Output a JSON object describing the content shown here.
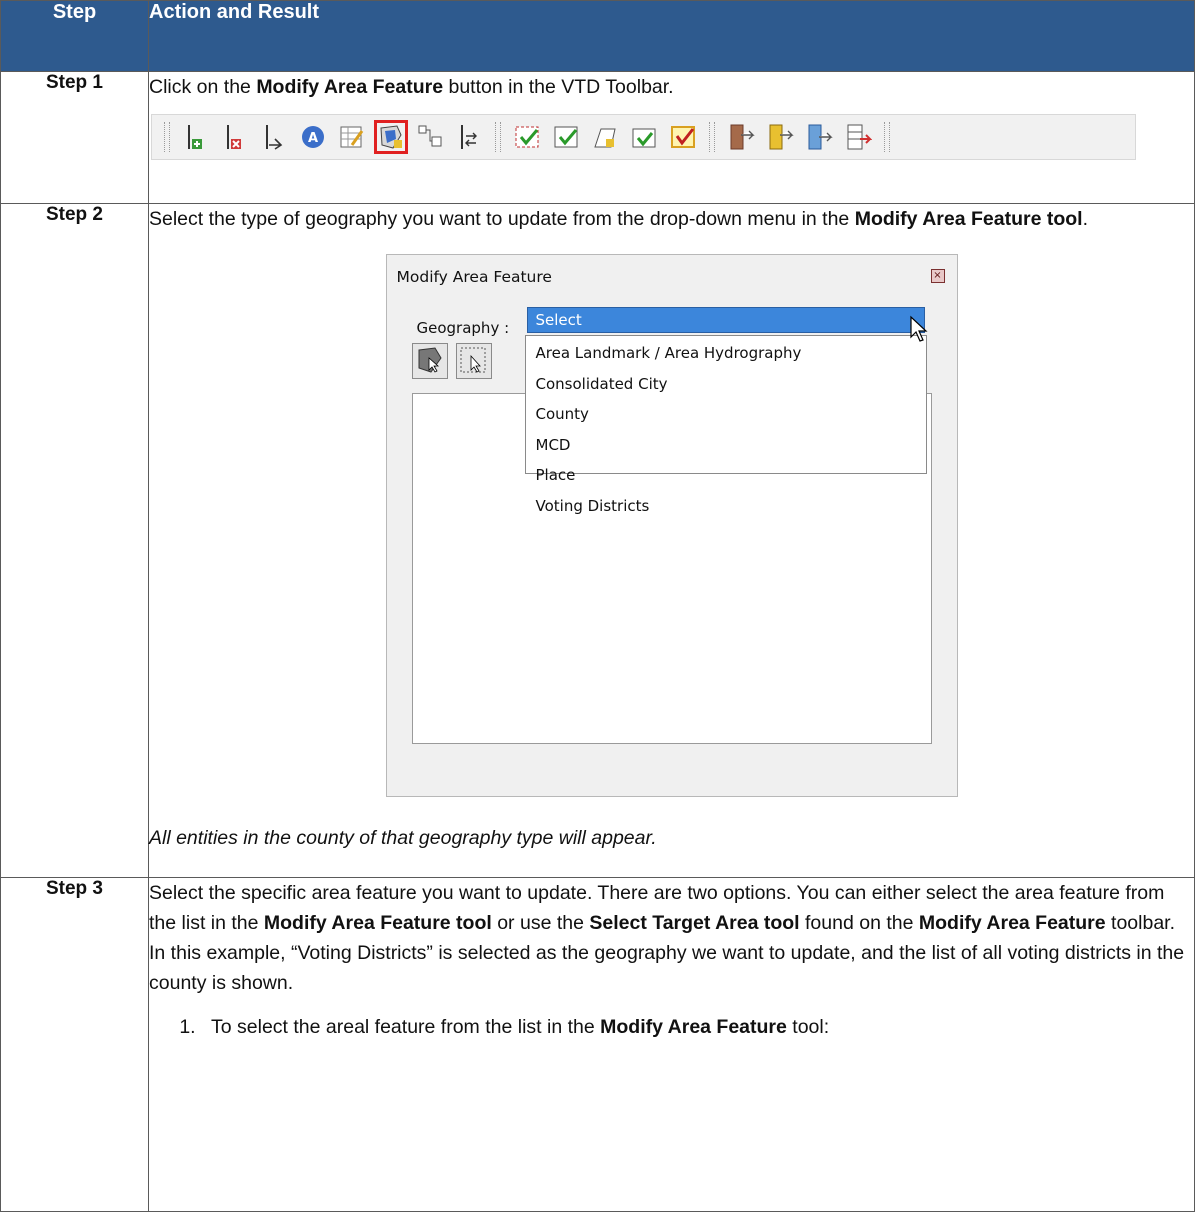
{
  "header": {
    "step_col": "Step",
    "action_col": "Action and Result"
  },
  "step1": {
    "label": "Step 1",
    "text_pre": "Click on the ",
    "text_bold": "Modify Area Feature",
    "text_post": " button in the VTD Toolbar."
  },
  "toolbar_icons": [
    "add-node-icon",
    "delete-node-icon",
    "split-line-icon",
    "attribute-a-icon",
    "edit-table-icon",
    "modify-area-feature-icon",
    "topology-icon",
    "flip-line-icon",
    "validate-feature-icon",
    "validate-selection-icon",
    "new-area-icon",
    "validate-check-icon",
    "review-icon",
    "export-left-icon",
    "export-right-icon",
    "export-blue-icon",
    "export-red-icon"
  ],
  "step2": {
    "label": "Step 2",
    "text_pre": "Select the type of geography you want to update from the drop-down menu in the ",
    "text_bold": "Modify Area Feature tool",
    "text_post": ".",
    "caption": "All entities in the county of that geography type will appear."
  },
  "dialog": {
    "title": "Modify Area Feature",
    "geography_label": "Geography :",
    "selected": "Select",
    "options": [
      "Area Landmark / Area Hydrography",
      "Consolidated City",
      "County",
      "MCD",
      "Place",
      "Voting Districts"
    ]
  },
  "step3": {
    "label": "Step 3",
    "t1": "Select the specific area feature you want to update. There are two options. You can either select the area feature from the list in the ",
    "b1": "Modify Area Feature tool",
    "t2": " or use the ",
    "b2": "Select Target Area tool",
    "t3": " found on the ",
    "b3": "Modify Area Feature",
    "t4": " toolbar. In this example, “Voting Districts” is selected as the geography we want to update, and the list of all voting districts in the county is shown.",
    "sub_text": "To select the areal feature from the list in the ",
    "sub_bold": "Modify Area Feature",
    "sub_post": " tool:"
  }
}
